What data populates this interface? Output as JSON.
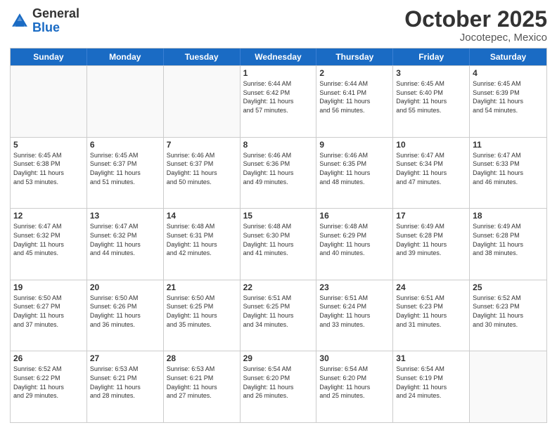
{
  "header": {
    "logo": {
      "general": "General",
      "blue": "Blue"
    },
    "title": "October 2025",
    "location": "Jocotepec, Mexico"
  },
  "days_of_week": [
    "Sunday",
    "Monday",
    "Tuesday",
    "Wednesday",
    "Thursday",
    "Friday",
    "Saturday"
  ],
  "weeks": [
    [
      {
        "day": "",
        "info": ""
      },
      {
        "day": "",
        "info": ""
      },
      {
        "day": "",
        "info": ""
      },
      {
        "day": "1",
        "info": "Sunrise: 6:44 AM\nSunset: 6:42 PM\nDaylight: 11 hours\nand 57 minutes."
      },
      {
        "day": "2",
        "info": "Sunrise: 6:44 AM\nSunset: 6:41 PM\nDaylight: 11 hours\nand 56 minutes."
      },
      {
        "day": "3",
        "info": "Sunrise: 6:45 AM\nSunset: 6:40 PM\nDaylight: 11 hours\nand 55 minutes."
      },
      {
        "day": "4",
        "info": "Sunrise: 6:45 AM\nSunset: 6:39 PM\nDaylight: 11 hours\nand 54 minutes."
      }
    ],
    [
      {
        "day": "5",
        "info": "Sunrise: 6:45 AM\nSunset: 6:38 PM\nDaylight: 11 hours\nand 53 minutes."
      },
      {
        "day": "6",
        "info": "Sunrise: 6:45 AM\nSunset: 6:37 PM\nDaylight: 11 hours\nand 51 minutes."
      },
      {
        "day": "7",
        "info": "Sunrise: 6:46 AM\nSunset: 6:37 PM\nDaylight: 11 hours\nand 50 minutes."
      },
      {
        "day": "8",
        "info": "Sunrise: 6:46 AM\nSunset: 6:36 PM\nDaylight: 11 hours\nand 49 minutes."
      },
      {
        "day": "9",
        "info": "Sunrise: 6:46 AM\nSunset: 6:35 PM\nDaylight: 11 hours\nand 48 minutes."
      },
      {
        "day": "10",
        "info": "Sunrise: 6:47 AM\nSunset: 6:34 PM\nDaylight: 11 hours\nand 47 minutes."
      },
      {
        "day": "11",
        "info": "Sunrise: 6:47 AM\nSunset: 6:33 PM\nDaylight: 11 hours\nand 46 minutes."
      }
    ],
    [
      {
        "day": "12",
        "info": "Sunrise: 6:47 AM\nSunset: 6:32 PM\nDaylight: 11 hours\nand 45 minutes."
      },
      {
        "day": "13",
        "info": "Sunrise: 6:47 AM\nSunset: 6:32 PM\nDaylight: 11 hours\nand 44 minutes."
      },
      {
        "day": "14",
        "info": "Sunrise: 6:48 AM\nSunset: 6:31 PM\nDaylight: 11 hours\nand 42 minutes."
      },
      {
        "day": "15",
        "info": "Sunrise: 6:48 AM\nSunset: 6:30 PM\nDaylight: 11 hours\nand 41 minutes."
      },
      {
        "day": "16",
        "info": "Sunrise: 6:48 AM\nSunset: 6:29 PM\nDaylight: 11 hours\nand 40 minutes."
      },
      {
        "day": "17",
        "info": "Sunrise: 6:49 AM\nSunset: 6:28 PM\nDaylight: 11 hours\nand 39 minutes."
      },
      {
        "day": "18",
        "info": "Sunrise: 6:49 AM\nSunset: 6:28 PM\nDaylight: 11 hours\nand 38 minutes."
      }
    ],
    [
      {
        "day": "19",
        "info": "Sunrise: 6:50 AM\nSunset: 6:27 PM\nDaylight: 11 hours\nand 37 minutes."
      },
      {
        "day": "20",
        "info": "Sunrise: 6:50 AM\nSunset: 6:26 PM\nDaylight: 11 hours\nand 36 minutes."
      },
      {
        "day": "21",
        "info": "Sunrise: 6:50 AM\nSunset: 6:25 PM\nDaylight: 11 hours\nand 35 minutes."
      },
      {
        "day": "22",
        "info": "Sunrise: 6:51 AM\nSunset: 6:25 PM\nDaylight: 11 hours\nand 34 minutes."
      },
      {
        "day": "23",
        "info": "Sunrise: 6:51 AM\nSunset: 6:24 PM\nDaylight: 11 hours\nand 33 minutes."
      },
      {
        "day": "24",
        "info": "Sunrise: 6:51 AM\nSunset: 6:23 PM\nDaylight: 11 hours\nand 31 minutes."
      },
      {
        "day": "25",
        "info": "Sunrise: 6:52 AM\nSunset: 6:23 PM\nDaylight: 11 hours\nand 30 minutes."
      }
    ],
    [
      {
        "day": "26",
        "info": "Sunrise: 6:52 AM\nSunset: 6:22 PM\nDaylight: 11 hours\nand 29 minutes."
      },
      {
        "day": "27",
        "info": "Sunrise: 6:53 AM\nSunset: 6:21 PM\nDaylight: 11 hours\nand 28 minutes."
      },
      {
        "day": "28",
        "info": "Sunrise: 6:53 AM\nSunset: 6:21 PM\nDaylight: 11 hours\nand 27 minutes."
      },
      {
        "day": "29",
        "info": "Sunrise: 6:54 AM\nSunset: 6:20 PM\nDaylight: 11 hours\nand 26 minutes."
      },
      {
        "day": "30",
        "info": "Sunrise: 6:54 AM\nSunset: 6:20 PM\nDaylight: 11 hours\nand 25 minutes."
      },
      {
        "day": "31",
        "info": "Sunrise: 6:54 AM\nSunset: 6:19 PM\nDaylight: 11 hours\nand 24 minutes."
      },
      {
        "day": "",
        "info": ""
      }
    ]
  ]
}
